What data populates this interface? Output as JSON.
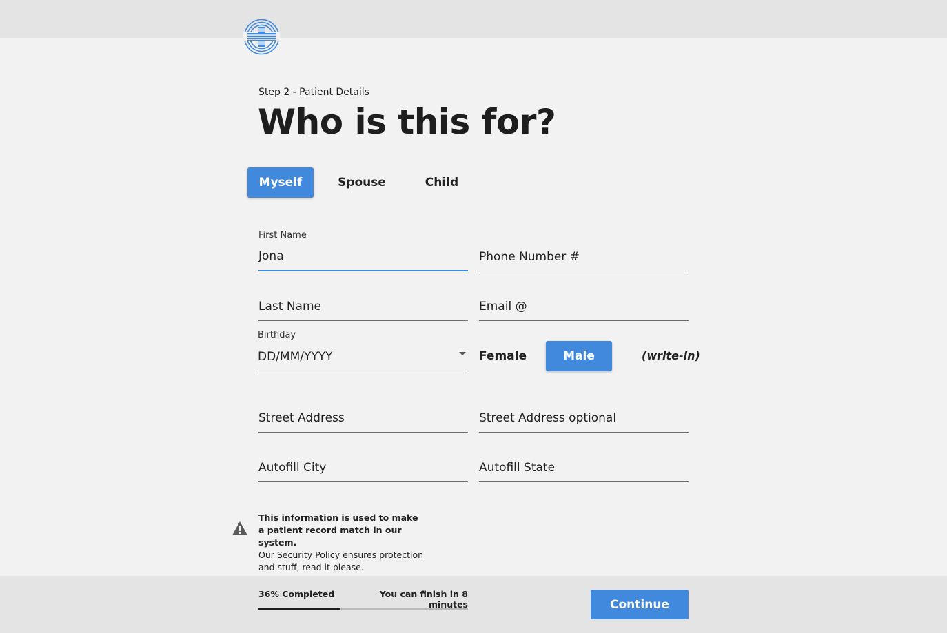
{
  "header": {
    "logo_icon": "medical-cross-logo-icon"
  },
  "step_label": "Step 2 - Patient Details",
  "page_title": "Who is this for?",
  "recipient_options": [
    {
      "label": "Myself",
      "selected": true
    },
    {
      "label": "Spouse",
      "selected": false
    },
    {
      "label": "Child",
      "selected": false
    }
  ],
  "form": {
    "first_name": {
      "label": "First Name",
      "value": "Jona"
    },
    "phone": {
      "placeholder": "Phone Number #"
    },
    "last_name": {
      "placeholder": "Last Name"
    },
    "email": {
      "placeholder": "Email @"
    },
    "birthday": {
      "label": "Birthday",
      "placeholder": "DD/MM/YYYY"
    },
    "gender": {
      "options": [
        {
          "label": "Female",
          "selected": false
        },
        {
          "label": "Male",
          "selected": true
        }
      ],
      "write_in": "(write-in)"
    },
    "street": {
      "placeholder": "Street Address"
    },
    "street_optional": {
      "placeholder": "Street Address optional"
    },
    "city": {
      "placeholder": "Autofill City"
    },
    "state": {
      "placeholder": "Autofill State"
    }
  },
  "notice": {
    "icon": "warning-icon",
    "bold_line1": "This information is used to make",
    "bold_line2": "a patient record match in our system.",
    "text_prefix": "Our ",
    "link_text": "Security Policy",
    "text_suffix": " ensures protection",
    "text_line4": "and stuff, read it please."
  },
  "footer": {
    "progress_label": "36% Completed",
    "progress_fraction": 0.39,
    "eta_label": "You can finish in 8 minutes",
    "continue_label": "Continue"
  },
  "colors": {
    "accent": "#4189dd",
    "background": "#f2f2f2",
    "bars": "#e4e4e4"
  }
}
